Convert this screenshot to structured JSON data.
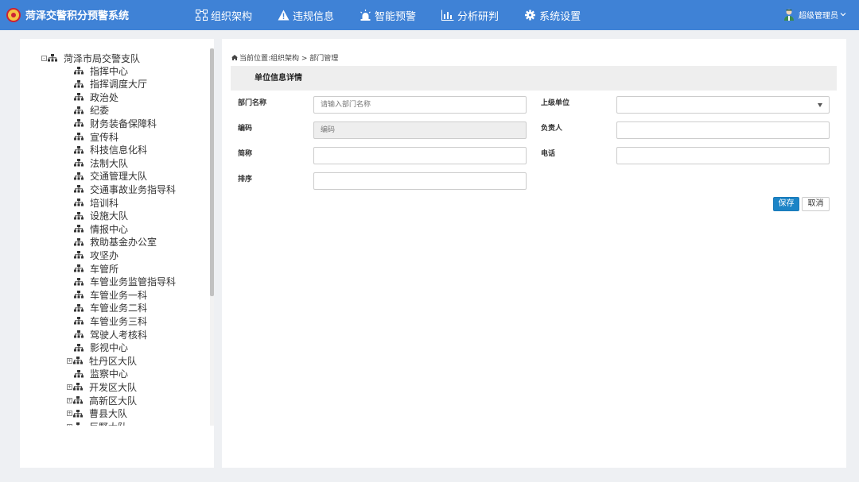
{
  "header": {
    "title": "菏泽交警积分预警系统",
    "nav": [
      {
        "label": "组织架构",
        "icon": "org-chart-icon"
      },
      {
        "label": "违规信息",
        "icon": "warning-icon"
      },
      {
        "label": "智能预警",
        "icon": "siren-icon"
      },
      {
        "label": "分析研判",
        "icon": "bar-chart-icon"
      },
      {
        "label": "系统设置",
        "icon": "gear-icon"
      }
    ],
    "user": "超级管理员"
  },
  "tree": {
    "root": "菏泽市局交警支队",
    "items": [
      {
        "label": "指挥中心",
        "expandable": false
      },
      {
        "label": "指挥调度大厅",
        "expandable": false
      },
      {
        "label": "政治处",
        "expandable": false
      },
      {
        "label": "纪委",
        "expandable": false
      },
      {
        "label": "财务装备保障科",
        "expandable": false
      },
      {
        "label": "宣传科",
        "expandable": false
      },
      {
        "label": "科技信息化科",
        "expandable": false
      },
      {
        "label": "法制大队",
        "expandable": false
      },
      {
        "label": "交通管理大队",
        "expandable": false
      },
      {
        "label": "交通事故业务指导科",
        "expandable": false
      },
      {
        "label": "培训科",
        "expandable": false
      },
      {
        "label": "设施大队",
        "expandable": false
      },
      {
        "label": "情报中心",
        "expandable": false
      },
      {
        "label": "救助基金办公室",
        "expandable": false
      },
      {
        "label": "攻坚办",
        "expandable": false
      },
      {
        "label": "车管所",
        "expandable": false
      },
      {
        "label": "车管业务监管指导科",
        "expandable": false
      },
      {
        "label": "车管业务一科",
        "expandable": false
      },
      {
        "label": "车管业务二科",
        "expandable": false
      },
      {
        "label": "车管业务三科",
        "expandable": false
      },
      {
        "label": "驾驶人考核科",
        "expandable": false
      },
      {
        "label": "影视中心",
        "expandable": false
      },
      {
        "label": "牡丹区大队",
        "expandable": true
      },
      {
        "label": "监察中心",
        "expandable": false
      },
      {
        "label": "开发区大队",
        "expandable": true
      },
      {
        "label": "高新区大队",
        "expandable": true
      },
      {
        "label": "曹县大队",
        "expandable": true
      },
      {
        "label": "巨野大队",
        "expandable": true
      }
    ]
  },
  "breadcrumb": {
    "prefix": "当前位置:",
    "path": "组织架构 > 部门管理"
  },
  "form": {
    "section_title": "单位信息详情",
    "dept_name_label": "部门名称",
    "dept_name_placeholder": "请输入部门名称",
    "dept_name_value": "",
    "parent_label": "上级单位",
    "parent_value": "",
    "code_label": "编码",
    "code_placeholder": "编码",
    "leader_label": "负责人",
    "leader_value": "",
    "short_label": "简称",
    "short_value": "",
    "phone_label": "电话",
    "phone_value": "",
    "order_label": "排序",
    "order_value": "",
    "save_label": "保存",
    "cancel_label": "取消"
  }
}
